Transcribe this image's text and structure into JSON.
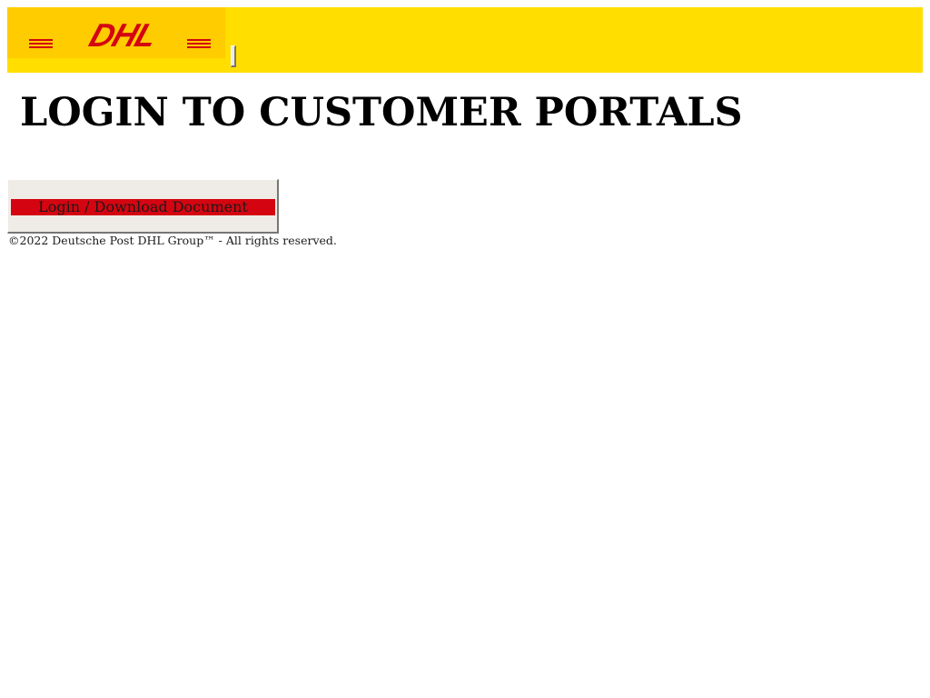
{
  "header": {
    "logo_text": "DHL",
    "brand_colors": {
      "yellow": "#FFDE00",
      "logo_bg": "#FFCC00",
      "red": "#D40511"
    },
    "menu_toggle_icon": "menu-toggle-icon"
  },
  "main": {
    "title": "LOGIN TO CUSTOMER PORTALS",
    "login_button_label": "Login / Download Document"
  },
  "footer": {
    "copyright": "©2022 Deutsche Post DHL Group™ - All rights reserved."
  }
}
